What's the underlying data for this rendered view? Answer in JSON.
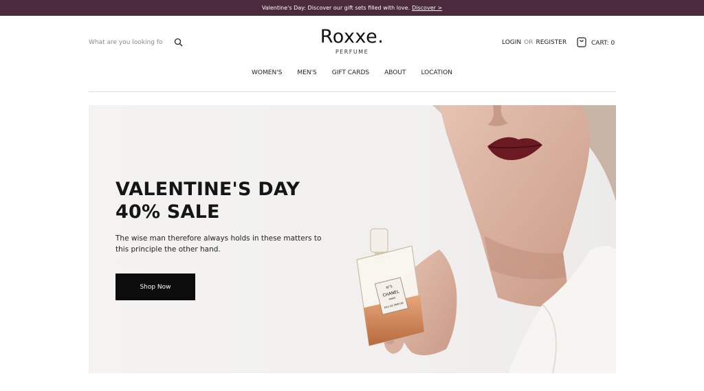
{
  "announcement": {
    "text": "Valentine's Day: Discover our gift sets filled with love.",
    "link": "Discover >"
  },
  "search": {
    "placeholder": "What are you looking for?",
    "icon": "search-icon"
  },
  "logo": {
    "name": "Roxxe.",
    "tagline": "PERFUME"
  },
  "account": {
    "login": "LOGIN",
    "or": "OR",
    "register": "REGISTER"
  },
  "cart": {
    "label": "CART: 0",
    "icon": "shopping-bag-icon"
  },
  "nav": [
    "WOMEN'S",
    "MEN'S",
    "GIFT CARDS",
    "ABOUT",
    "LOCATION"
  ],
  "hero": {
    "title_line1": "VALENTINE'S DAY",
    "title_line2": "40% SALE",
    "subtitle": "The wise man therefore always holds in these matters to this principle the other hand.",
    "cta": "Shop Now",
    "bottle_label": {
      "line1": "N°5",
      "line2": "CHANEL",
      "line3": "PARIS",
      "line4": "EAU DE PARFUM"
    }
  },
  "colors": {
    "announcement_bg": "#4a2a3c",
    "button_bg": "#0c0c0c",
    "lip": "#6b1a24"
  }
}
